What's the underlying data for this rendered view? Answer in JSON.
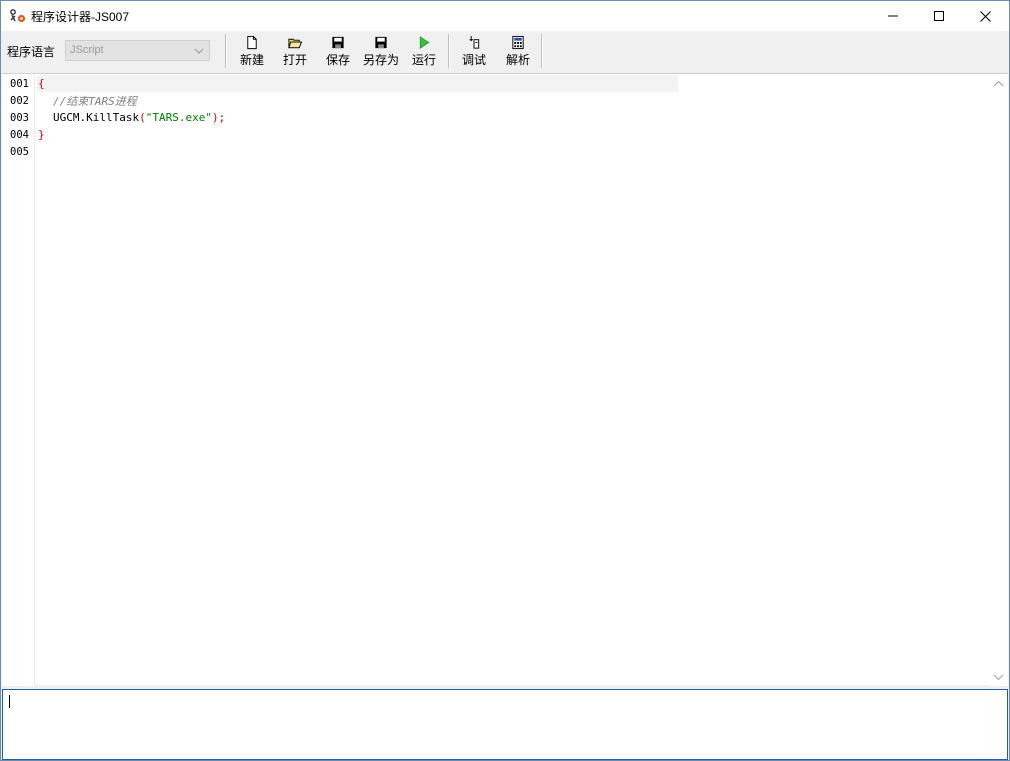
{
  "window": {
    "title": "程序设计器-JS007"
  },
  "toolbar": {
    "language_label": "程序语言",
    "language_value": "JScript",
    "buttons": {
      "new": "新建",
      "open": "打开",
      "save": "保存",
      "save_as": "另存为",
      "run": "运行",
      "debug": "调试",
      "parse": "解析"
    }
  },
  "editor": {
    "line_numbers": [
      "001",
      "002",
      "003",
      "004",
      "005"
    ],
    "lines": {
      "l1": {
        "brace": "{"
      },
      "l2": {
        "comment": "//结束TARS进程"
      },
      "l3": {
        "call": "UGCM.KillTask",
        "open_paren": "(",
        "string": "\"TARS.exe\"",
        "close": ");"
      },
      "l4": {
        "brace": "}"
      }
    }
  },
  "output": {
    "text": ""
  }
}
